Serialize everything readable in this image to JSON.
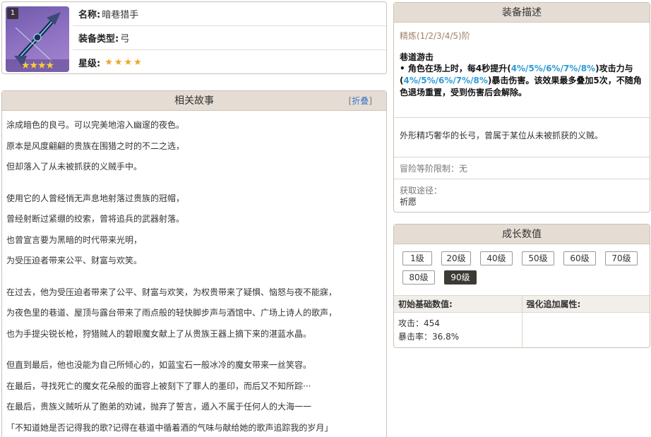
{
  "info": {
    "badge": "1",
    "thumb_stars": "★★★★",
    "name_label": "名称:",
    "name_value": "暗巷猎手",
    "type_label": "装备类型:",
    "type_value": "弓",
    "rarity_label": "星级:",
    "rarity_stars": "★★★★"
  },
  "story": {
    "title": "相关故事",
    "fold_open": "[",
    "fold_label": "折叠",
    "fold_close": "]",
    "paragraphs": [
      [
        "涂成暗色的良弓。可以完美地溶入幽邃的夜色。",
        "原本是风度翩翩的贵族在围猎之时的不二之选，",
        "但却落入了从未被抓获的义贼手中。"
      ],
      [
        "使用它的人曾经悄无声息地射落过贵族的冠帽，",
        "曾经射断过紧绷的绞索，曾将追兵的武器射落。",
        "也曾宣言要为黑暗的时代带来光明，",
        "为受压迫者带来公平、财富与欢笑。"
      ],
      [
        "在过去，他为受压迫者带来了公平、财富与欢笑，为权贵带来了疑惧、恼怒与夜不能寐，",
        "为夜色里的巷道、屋顶与露台带来了雨点般的轻快脚步声与酒馆中、广场上诗人的歌声，",
        "也为手提尖锐长枪，狩猎贼人的碧眼魔女献上了从贵族王器上摘下来的湛蓝水晶。"
      ],
      [
        "但直到最后，他也没能为自己所倾心的，如蓝宝石一般冰冷的魔女带来一丝笑容。",
        "在最后，寻找死亡的魔女花朵般的面容上被刻下了罪人的墨印，而后又不知所踪···",
        "在最后，贵族义贼听从了胞弟的劝诫，抛弃了誓言，遁入不属于任何人的大海一一",
        "「不知道她是否记得我的歌?记得在巷道中循着酒的气味与献给她的歌声追踪我的岁月」"
      ]
    ]
  },
  "desc": {
    "title": "装备描述",
    "refine": "精炼(1/2/3/4/5)阶",
    "passive_name": "巷道游击",
    "passive_p1": "• 角色在场上时，每4秒提升(",
    "passive_hl1": "4%/5%/6%/7%/8%",
    "passive_p2": ")攻击力与(",
    "passive_hl2": "4%/5%/6%/7%/8%",
    "passive_p3": ")暴击伤害。该效果最多叠加5次，不随角色退场重置，受到伤害后会解除。",
    "flavor": "外形精巧奢华的长弓，曾属于某位从未被抓获的义贼。",
    "rank_label": "冒险等阶限制：",
    "rank_value": "无",
    "source_label": "获取途径：",
    "source_value": "祈愿"
  },
  "growth": {
    "title": "成长数值",
    "levels": [
      "1级",
      "20级",
      "40级",
      "50级",
      "60级",
      "70级",
      "80级",
      "90级"
    ],
    "active_level": "90级",
    "base_header": "初始基础数值:",
    "bonus_header": "强化追加属性:",
    "atk_label": "攻击：",
    "atk_value": "454",
    "crit_label": "暴击率：",
    "crit_value": "36.8%"
  },
  "colors": {
    "header_bg": "#e5ddd4",
    "highlight": "#2e9ad6",
    "star": "#f0a52a",
    "active_level_bg": "#3d3a36"
  }
}
